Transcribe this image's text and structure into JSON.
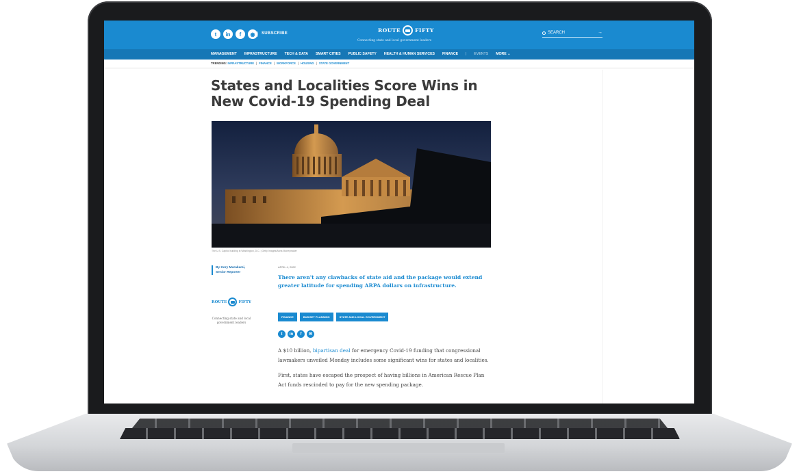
{
  "header": {
    "social_icons": [
      "twitter-icon",
      "linkedin-icon",
      "facebook-icon",
      "rss-icon"
    ],
    "subscribe_label": "SUBSCRIBE",
    "logo_left": "ROUTE",
    "logo_right": "FIFTY",
    "tagline": "Connecting state and local government leaders",
    "search_label": "SEARCH",
    "search_arrow": "→"
  },
  "nav": {
    "items": [
      "MANAGEMENT",
      "INFRASTRUCTURE",
      "TECH & DATA",
      "SMART CITIES",
      "PUBLIC SAFETY",
      "HEALTH & HUMAN SERVICES",
      "FINANCE",
      "|",
      "EVENTS",
      "MORE ⌄"
    ]
  },
  "trending": {
    "label": "TRENDING:",
    "items": [
      "INFRASTRUCTURE",
      "FINANCE",
      "WORKFORCE",
      "HOUSING",
      "STATE GOVERNMENT"
    ]
  },
  "article": {
    "headline": "States and Localities Score Wins in New Covid-19 Spending Deal",
    "caption": "The U.S. Capitol building in Washington, D.C. | Getty Images/Anna Moneymaker",
    "byline_name": "By Kery Murakami,",
    "byline_title": "Senior Reporter",
    "date": "APRIL 4, 2022",
    "dek": "There aren't any clawbacks of state aid and the package would extend greater latitude for spending ARPA dollars on infrastructure.",
    "tags": [
      "FINANCE",
      "BUDGET PLANNING",
      "STATE AND LOCAL GOVERNMENT"
    ],
    "share_icons": [
      "twitter-icon",
      "linkedin-icon",
      "facebook-icon",
      "email-icon"
    ],
    "p1_before": "A $10 billion, ",
    "p1_link": "bipartisan deal",
    "p1_after": " for emergency Covid-19 funding that congressional lawmakers unveiled Monday includes some significant wins for states and localities.",
    "p2": "First, states have escaped the prospect of having billions in American Rescue Plan Act funds rescinded to pay for the new spending package."
  },
  "sidebar": {
    "logo_left": "ROUTE",
    "logo_right": "FIFTY",
    "tagline": "Connecting state and local government leaders"
  },
  "colors": {
    "brand_blue": "#1a8ad0",
    "nav_blue": "#1677b6",
    "headline": "#3b3b3b"
  }
}
